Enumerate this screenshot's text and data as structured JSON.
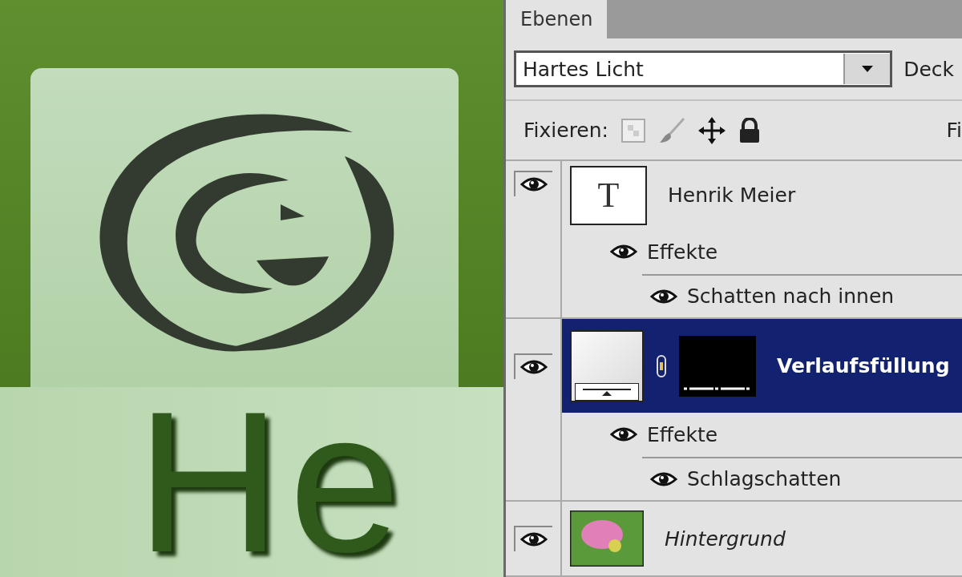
{
  "canvas": {
    "text": "He"
  },
  "panel": {
    "tabs": [
      {
        "label": "Ebenen",
        "selected": true
      }
    ],
    "blend_mode": {
      "value": "Hartes Licht"
    },
    "opacity_label": "Deck",
    "lock_label": "Fixieren:",
    "fill_label": "Fi",
    "layers": [
      {
        "kind": "text",
        "thumbnail_glyph": "T",
        "name": "Henrik Meier",
        "visible": true,
        "selected": false,
        "effects": {
          "label": "Effekte",
          "visible": true,
          "items": [
            {
              "name": "Schatten nach innen",
              "visible": true
            }
          ]
        }
      },
      {
        "kind": "fill",
        "name": "Verlaufsfüllung",
        "visible": true,
        "selected": true,
        "effects": {
          "label": "Effekte",
          "visible": true,
          "items": [
            {
              "name": "Schlagschatten",
              "visible": true
            }
          ]
        }
      },
      {
        "kind": "image",
        "name": "Hintergrund",
        "visible": true,
        "selected": false
      }
    ]
  }
}
